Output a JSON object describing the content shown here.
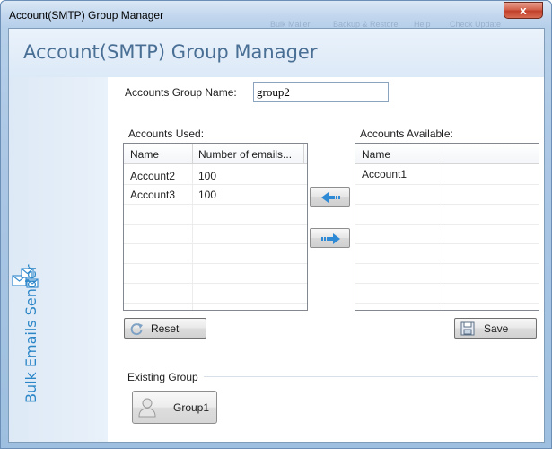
{
  "window": {
    "title": "Account(SMTP) Group Manager",
    "close_label": "x",
    "background_hints": [
      "Bulk Mailer",
      "Backup & Restore",
      "Help",
      "Check Update"
    ]
  },
  "header": {
    "title": "Account(SMTP) Group Manager"
  },
  "sidebar": {
    "brand": "Bulk Emails Sender",
    "icon": "envelopes-icon"
  },
  "form": {
    "group_name_label": "Accounts Group Name:",
    "group_name_value": "group2"
  },
  "accounts_used": {
    "label": "Accounts Used:",
    "columns": [
      "Name",
      "Number of emails..."
    ],
    "rows": [
      {
        "name": "Account2",
        "count": "100"
      },
      {
        "name": "Account3",
        "count": "100"
      }
    ]
  },
  "accounts_available": {
    "label": "Accounts Available:",
    "columns": [
      "Name"
    ],
    "rows": [
      {
        "name": "Account1"
      }
    ]
  },
  "transfer": {
    "move_left_icon": "arrow-left-icon",
    "move_right_icon": "arrow-right-icon"
  },
  "buttons": {
    "reset_label": "Reset",
    "save_label": "Save"
  },
  "existing_group": {
    "label": "Existing Group",
    "groups": [
      "Group1"
    ]
  },
  "colors": {
    "accent_blue": "#2b86c7",
    "title_blue": "#4a6f95",
    "close_red": "#c1402b"
  }
}
